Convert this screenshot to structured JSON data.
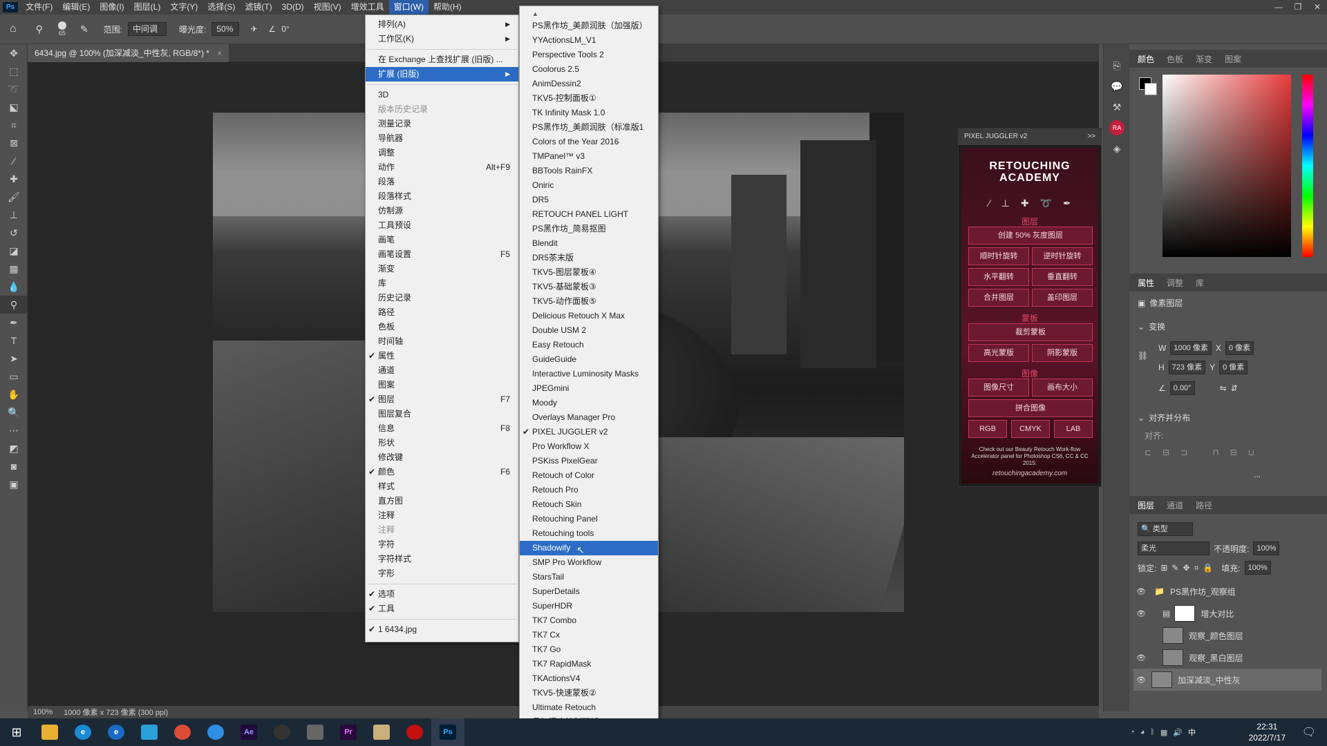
{
  "menubar": {
    "logo": "Ps",
    "items": [
      "文件(F)",
      "编辑(E)",
      "图像(I)",
      "图层(L)",
      "文字(Y)",
      "选择(S)",
      "滤镜(T)",
      "3D(D)",
      "视图(V)",
      "增效工具",
      "窗口(W)",
      "帮助(H)"
    ]
  },
  "options": {
    "brush_size": "65",
    "range_label": "范围:",
    "range_value": "中间调",
    "exposure_label": "曝光度:",
    "exposure_value": "50%",
    "angle_value": "0°"
  },
  "document": {
    "tab_title": "6434.jpg @ 100% (加深减淡_中性灰, RGB/8*) *",
    "tab_close": "×",
    "zoom": "100%",
    "info": "1000 像素 x 723 像素 (300 ppi)"
  },
  "window_menu": {
    "items": [
      {
        "label": "排列(A)",
        "arrow": "▶"
      },
      {
        "label": "工作区(K)",
        "arrow": "▶"
      },
      {
        "sep": true
      },
      {
        "label": "在 Exchange 上查找扩展 (旧版) ..."
      },
      {
        "label": "扩展 (旧版)",
        "arrow": "▶",
        "highlight": true
      },
      {
        "sep": true
      },
      {
        "label": "3D"
      },
      {
        "label": "版本历史记录",
        "disabled": true
      },
      {
        "label": "测量记录"
      },
      {
        "label": "导航器"
      },
      {
        "label": "调整"
      },
      {
        "label": "动作",
        "shortcut": "Alt+F9"
      },
      {
        "label": "段落"
      },
      {
        "label": "段落样式"
      },
      {
        "label": "仿制源"
      },
      {
        "label": "工具预设"
      },
      {
        "label": "画笔"
      },
      {
        "label": "画笔设置",
        "shortcut": "F5"
      },
      {
        "label": "渐变"
      },
      {
        "label": "库"
      },
      {
        "label": "历史记录"
      },
      {
        "label": "路径"
      },
      {
        "label": "色板"
      },
      {
        "label": "时间轴"
      },
      {
        "label": "属性",
        "checked": true
      },
      {
        "label": "通道"
      },
      {
        "label": "图案"
      },
      {
        "label": "图层",
        "checked": true,
        "shortcut": "F7"
      },
      {
        "label": "图层复合"
      },
      {
        "label": "信息",
        "shortcut": "F8"
      },
      {
        "label": "形状"
      },
      {
        "label": "修改键"
      },
      {
        "label": "颜色",
        "checked": true,
        "shortcut": "F6"
      },
      {
        "label": "样式"
      },
      {
        "label": "直方图"
      },
      {
        "label": "注释"
      },
      {
        "label": "注释",
        "disabled": true
      },
      {
        "label": "字符"
      },
      {
        "label": "字符样式"
      },
      {
        "label": "字形"
      },
      {
        "sep": true
      },
      {
        "label": "选项",
        "checked": true
      },
      {
        "label": "工具",
        "checked": true
      },
      {
        "sep": true
      },
      {
        "label": "1 6434.jpg",
        "checked": true
      }
    ]
  },
  "extensions_menu": {
    "up_arrow": "▲",
    "down_arrow": "▼",
    "items": [
      {
        "label": "PS黑作坊_美颜润肤（加强版）"
      },
      {
        "label": "YYActionsLM_V1"
      },
      {
        "label": "Perspective Tools 2"
      },
      {
        "label": "Coolorus 2.5"
      },
      {
        "label": "AnimDessin2"
      },
      {
        "label": "TKV5-控制面板①"
      },
      {
        "label": "TK Infinity Mask 1.0"
      },
      {
        "label": "PS黑作坊_美颜润肤（标准版1"
      },
      {
        "label": "Colors of the Year 2016"
      },
      {
        "label": "TMPanel™ v3"
      },
      {
        "label": "BBTools RainFX"
      },
      {
        "label": "Oniric"
      },
      {
        "label": "DR5"
      },
      {
        "label": "RETOUCH PANEL LIGHT"
      },
      {
        "label": "PS黑作坊_简易抠图"
      },
      {
        "label": "Blendit"
      },
      {
        "label": "DR5茶末版"
      },
      {
        "label": "TKV5-图层蒙板④"
      },
      {
        "label": "TKV5-基础蒙板③"
      },
      {
        "label": "TKV5-动作面板⑤"
      },
      {
        "label": "Delicious Retouch X Max"
      },
      {
        "label": "Double USM 2"
      },
      {
        "label": "Easy Retouch"
      },
      {
        "label": "GuideGuide"
      },
      {
        "label": "Interactive Luminosity Masks"
      },
      {
        "label": "JPEGmini"
      },
      {
        "label": "Moody"
      },
      {
        "label": "Overlays Manager Pro"
      },
      {
        "label": "PIXEL JUGGLER v2",
        "checked": true
      },
      {
        "label": "Pro Workflow X"
      },
      {
        "label": "PSKiss PixelGear"
      },
      {
        "label": "Retouch of Color"
      },
      {
        "label": "Retouch Pro"
      },
      {
        "label": "Retouch Skin"
      },
      {
        "label": "Retouching Panel"
      },
      {
        "label": "Retouching tools"
      },
      {
        "label": "Shadowify",
        "highlight": true
      },
      {
        "label": "SMP Pro Workflow"
      },
      {
        "label": "StarsTail"
      },
      {
        "label": "SuperDetails"
      },
      {
        "label": "SuperHDR"
      },
      {
        "label": "TK7 Combo"
      },
      {
        "label": "TK7 Cx"
      },
      {
        "label": "TK7 Go"
      },
      {
        "label": "TK7 RapidMask"
      },
      {
        "label": "TKActionsV4"
      },
      {
        "label": "TKV5-快速蒙板②"
      },
      {
        "label": "Ultimate Retouch"
      },
      {
        "label": "叠加混合控制面板"
      }
    ]
  },
  "pixel_juggler": {
    "title": "PIXEL JUGGLER v2",
    "collapse": ">>",
    "logo_line1": "RETOUCHING",
    "logo_line2": "ACADEMY",
    "section_layer": "图层",
    "btn_gray": "创建 50% 灰度图层",
    "btn_cw": "顺时针旋转",
    "btn_ccw": "逆时针旋转",
    "btn_hflip": "水平翻转",
    "btn_vflip": "垂直翻转",
    "btn_merge": "合并图层",
    "btn_stamp": "盖印图层",
    "section_mask": "蒙板",
    "btn_clip": "裁剪蒙板",
    "btn_hl": "高光蒙版",
    "btn_sh": "阴影蒙版",
    "section_image": "图像",
    "btn_size": "图像尺寸",
    "btn_canvas": "画布大小",
    "btn_flatten": "拼合图像",
    "btn_rgb": "RGB",
    "btn_cmyk": "CMYK",
    "btn_lab": "LAB",
    "footer": "Check out our Beauty Retouch Work-flow Accelerator panel for Photoshop CS6, CC & CC 2015:",
    "url": "retouchingacademy.com"
  },
  "right_panel": {
    "color_tabs": [
      "颜色",
      "色板",
      "渐变",
      "图案"
    ],
    "props_tabs": [
      "属性",
      "调整",
      "库"
    ],
    "pixel_layer": "像素图层",
    "transform": "变换",
    "w_label": "W",
    "w_value": "1000 像素",
    "x_label": "X",
    "x_value": "0 像素",
    "h_label": "H",
    "h_value": "723 像素",
    "y_label": "Y",
    "y_value": "0 像素",
    "angle": "0.00°",
    "align": "对齐并分布",
    "align_sub": "对齐:",
    "more": "...",
    "layers_tabs": [
      "图层",
      "通道",
      "路径"
    ],
    "filter_kind": "类型",
    "blend_mode": "柔光",
    "opacity_label": "不透明度:",
    "opacity": "100%",
    "lock_label": "锁定:",
    "fill_label": "填充:",
    "fill": "100%",
    "layers": [
      {
        "name": "PS黑作坊_观察组",
        "visible": true,
        "group": true
      },
      {
        "name": "增大对比",
        "visible": true
      },
      {
        "name": "观察_颜色图层",
        "visible": false
      },
      {
        "name": "观察_黑白图层",
        "visible": true
      },
      {
        "name": "加深减淡_中性灰",
        "visible": true,
        "selected": true
      }
    ]
  },
  "taskbar": {
    "ime": "中",
    "time": "22:31",
    "date": "2022/7/17",
    "apps": [
      "Ae",
      "Pr",
      "Ps"
    ]
  },
  "colors": {
    "highlight": "#2c6cc6",
    "panel_bg": "#535353",
    "pj_accent": "#c43559"
  }
}
